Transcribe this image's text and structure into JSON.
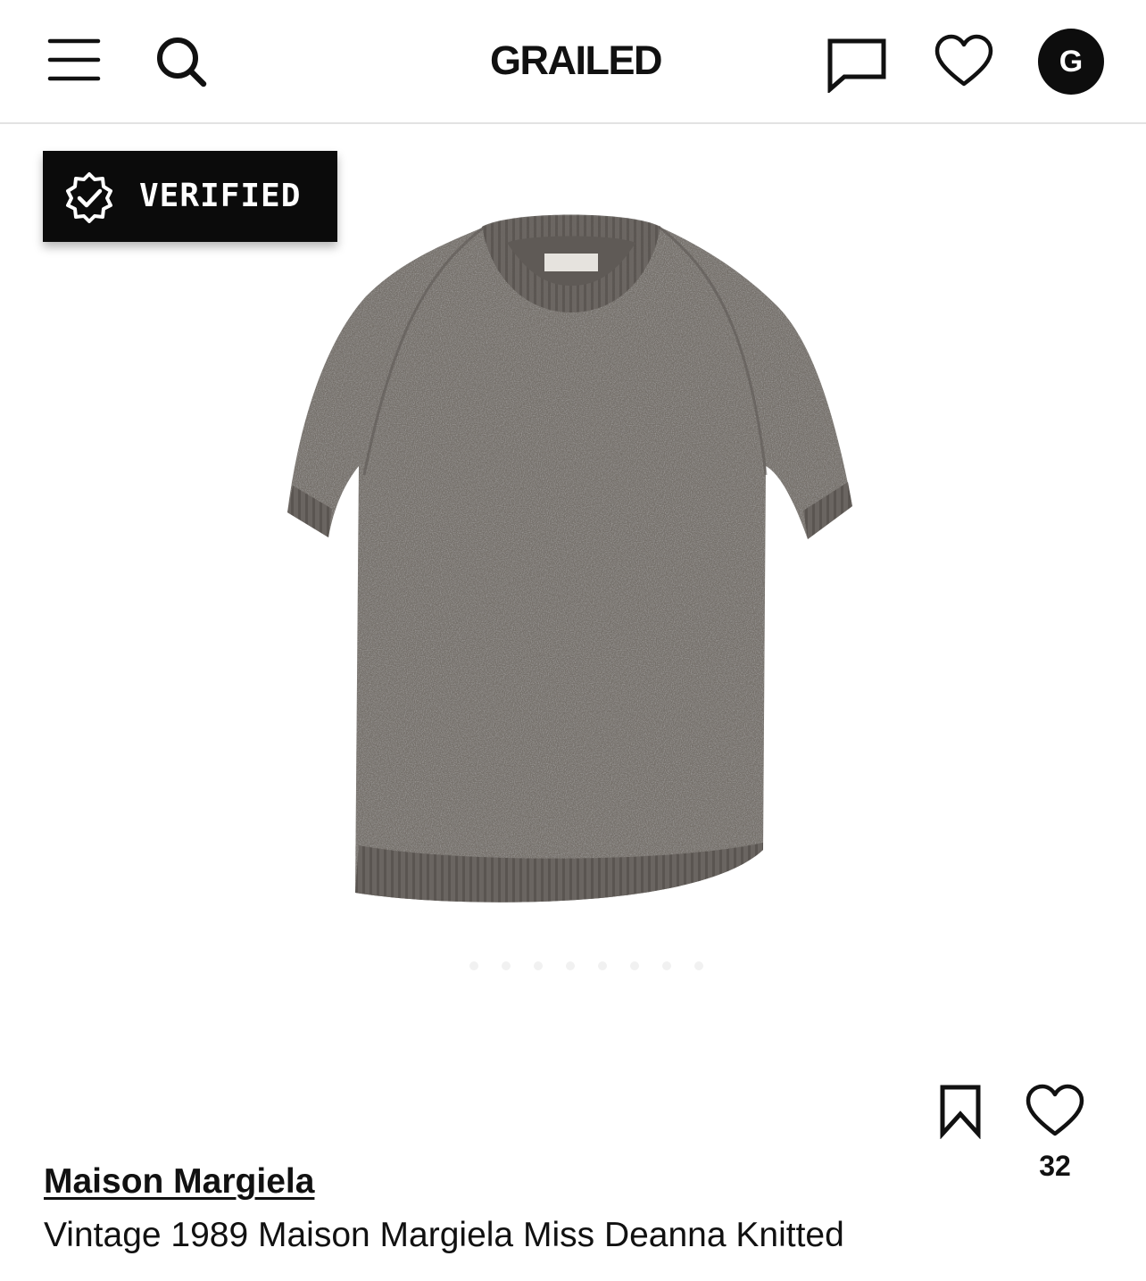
{
  "header": {
    "logo_text": "GRAILED",
    "avatar_initial": "G",
    "icons": [
      "hamburger-menu-icon",
      "search-icon",
      "message-icon",
      "heart-icon"
    ]
  },
  "badge": {
    "label": "VERIFIED",
    "icon": "verified-check-icon"
  },
  "gallery": {
    "image_description": "grey knitted short-sleeve sweater",
    "dot_count": 8,
    "active_dot": 1
  },
  "actions": {
    "save_icon": "bookmark-icon",
    "like_icon": "heart-icon",
    "like_count": "32"
  },
  "listing": {
    "brand": "Maison Margiela",
    "title": "Vintage 1989 Maison Margiela Miss Deanna Knitted"
  },
  "colors": {
    "text": "#111111",
    "badge_bg": "#0b0b0b",
    "divider": "#e2e2e2",
    "sweater": "#6f6a66"
  }
}
